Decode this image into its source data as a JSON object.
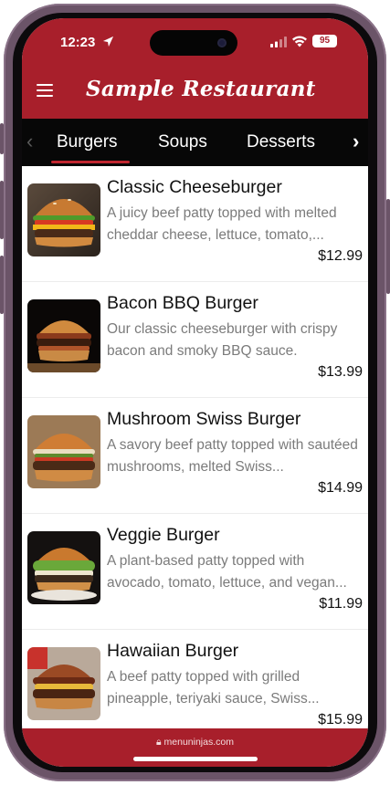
{
  "status": {
    "time": "12:23",
    "battery": "95"
  },
  "header": {
    "title": "Sample Restaurant"
  },
  "tabs": [
    {
      "label": "Burgers"
    },
    {
      "label": "Soups"
    },
    {
      "label": "Desserts"
    }
  ],
  "items": [
    {
      "name": "Classic Cheeseburger",
      "description": "A juicy beef patty topped with melted cheddar cheese, lettuce, tomato,...",
      "price": "$12.99"
    },
    {
      "name": "Bacon BBQ Burger",
      "description": "Our classic cheeseburger with crispy bacon and smoky BBQ sauce.",
      "price": "$13.99"
    },
    {
      "name": "Mushroom Swiss Burger",
      "description": "A savory beef patty topped with sautéed mushrooms, melted Swiss...",
      "price": "$14.99"
    },
    {
      "name": "Veggie Burger",
      "description": "A plant-based patty topped with avocado, tomato, lettuce, and vegan...",
      "price": "$11.99"
    },
    {
      "name": "Hawaiian Burger",
      "description": "A beef patty topped with grilled pineapple, teriyaki sauce, Swiss...",
      "price": "$15.99"
    }
  ],
  "footer": {
    "url": "menuninjas.com"
  },
  "colors": {
    "brand_red": "#a81f2b",
    "tab_bar": "#070707",
    "tab_underline": "#c0262f"
  },
  "icons": {
    "menu": "hamburger-menu-icon",
    "tab_prev": "chevron-left-icon",
    "tab_next": "chevron-right-icon",
    "location": "location-arrow-icon",
    "lock": "lock-icon"
  }
}
